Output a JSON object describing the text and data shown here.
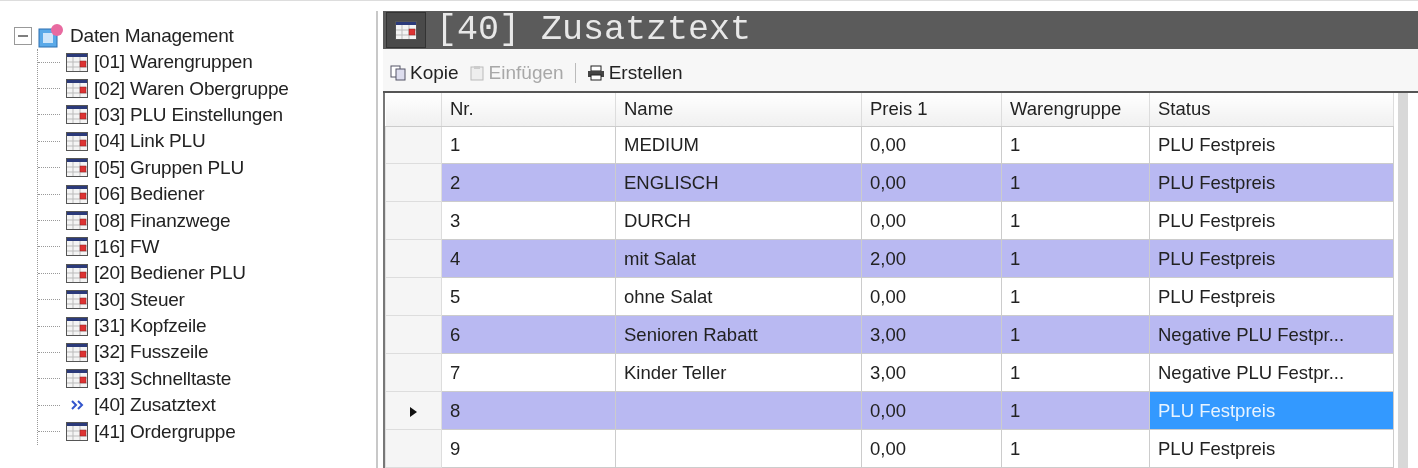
{
  "tree": {
    "root": {
      "label": "Daten Management",
      "expanded": true,
      "children": [
        {
          "label": "[01] Warengruppen",
          "current": false
        },
        {
          "label": "[02] Waren Obergruppe",
          "current": false
        },
        {
          "label": "[03] PLU Einstellungen",
          "current": false
        },
        {
          "label": "[04] Link PLU",
          "current": false
        },
        {
          "label": "[05] Gruppen PLU",
          "current": false
        },
        {
          "label": "[06] Bediener",
          "current": false
        },
        {
          "label": "[08] Finanzwege",
          "current": false
        },
        {
          "label": "[16] FW",
          "current": false
        },
        {
          "label": "[20] Bediener PLU",
          "current": false
        },
        {
          "label": "[30] Steuer",
          "current": false
        },
        {
          "label": "[31] Kopfzeile",
          "current": false
        },
        {
          "label": "[32] Fusszeile",
          "current": false
        },
        {
          "label": "[33] Schnelltaste",
          "current": false
        },
        {
          "label": "[40] Zusatztext",
          "current": true
        },
        {
          "label": "[41] Ordergruppe",
          "current": false
        }
      ]
    }
  },
  "panel": {
    "title": "[40] Zusatztext",
    "toolbar": [
      {
        "label": "Kopie",
        "kind": "copy",
        "disabled": false
      },
      {
        "label": "Einfügen",
        "kind": "paste",
        "disabled": true
      },
      {
        "label": "Erstellen",
        "kind": "create",
        "disabled": false
      }
    ],
    "table": {
      "columns": [
        "Nr.",
        "Name",
        "Preis 1",
        "Warengruppe",
        "Status"
      ],
      "rows": [
        {
          "cells": [
            "1",
            "MEDIUM",
            "0,00",
            "1",
            "PLU Festpreis"
          ],
          "selected": false
        },
        {
          "cells": [
            "2",
            "ENGLISCH",
            "0,00",
            "1",
            "PLU Festpreis"
          ],
          "selected": false
        },
        {
          "cells": [
            "3",
            "DURCH",
            "0,00",
            "1",
            "PLU Festpreis"
          ],
          "selected": false
        },
        {
          "cells": [
            "4",
            "mit Salat",
            "2,00",
            "1",
            "PLU Festpreis"
          ],
          "selected": false
        },
        {
          "cells": [
            "5",
            "ohne Salat",
            "0,00",
            "1",
            "PLU Festpreis"
          ],
          "selected": false
        },
        {
          "cells": [
            "6",
            "Senioren Rabatt",
            "3,00",
            "1",
            "Negative PLU Festpr..."
          ],
          "selected": false
        },
        {
          "cells": [
            "7",
            "Kinder Teller",
            "3,00",
            "1",
            "Negative PLU Festpr..."
          ],
          "selected": false
        },
        {
          "cells": [
            "8",
            "",
            "0,00",
            "1",
            "PLU Festpreis"
          ],
          "selected": true
        },
        {
          "cells": [
            "9",
            "",
            "0,00",
            "1",
            "PLU Festpreis"
          ],
          "selected": false
        }
      ]
    }
  }
}
